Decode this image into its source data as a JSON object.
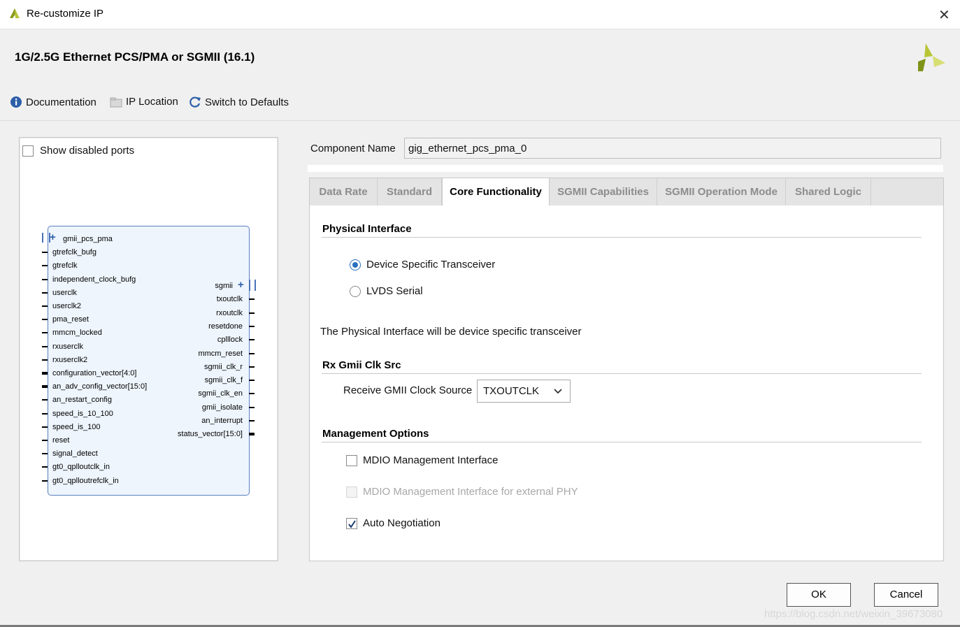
{
  "window": {
    "title": "Re-customize IP",
    "close_label": "✕"
  },
  "header": {
    "title": "1G/2.5G Ethernet PCS/PMA or SGMII (16.1)",
    "toolbar": {
      "documentation": "Documentation",
      "ip_location": "IP Location",
      "switch_defaults": "Switch to Defaults"
    }
  },
  "left": {
    "show_disabled_ports": "Show disabled ports",
    "symbol": {
      "inputs": [
        "gmii_pcs_pma",
        "gtrefclk_bufg",
        "gtrefclk",
        "independent_clock_bufg",
        "userclk",
        "userclk2",
        "pma_reset",
        "mmcm_locked",
        "rxuserclk",
        "rxuserclk2",
        "configuration_vector[4:0]",
        "an_adv_config_vector[15:0]",
        "an_restart_config",
        "speed_is_10_100",
        "speed_is_100",
        "reset",
        "signal_detect",
        "gt0_qplloutclk_in",
        "gt0_qplloutrefclk_in"
      ],
      "outputs": [
        "sgmii",
        "txoutclk",
        "rxoutclk",
        "resetdone",
        "cplllock",
        "mmcm_reset",
        "sgmii_clk_r",
        "sgmii_clk_f",
        "sgmii_clk_en",
        "gmii_isolate",
        "an_interrupt",
        "status_vector[15:0]"
      ]
    }
  },
  "component": {
    "label": "Component Name",
    "value": "gig_ethernet_pcs_pma_0"
  },
  "tabs": [
    "Data Rate",
    "Standard",
    "Core Functionality",
    "SGMII Capabilities",
    "SGMII Operation Mode",
    "Shared Logic"
  ],
  "active_tab": "Core Functionality",
  "core": {
    "physical_interface": {
      "heading": "Physical Interface",
      "options": [
        "Device Specific Transceiver",
        "LVDS Serial"
      ],
      "selected": "Device Specific Transceiver",
      "note": "The Physical Interface will be device specific transceiver"
    },
    "rx_gmii": {
      "heading": "Rx Gmii Clk Src",
      "label": "Receive GMII Clock Source",
      "value": "TXOUTCLK"
    },
    "management": {
      "heading": "Management Options",
      "mdio": "MDIO Management Interface",
      "mdio_ext": "MDIO Management Interface for external PHY",
      "auto_neg": "Auto Negotiation"
    }
  },
  "buttons": {
    "ok": "OK",
    "cancel": "Cancel"
  },
  "watermark": "https://blog.csdn.net/weixin_39673080"
}
